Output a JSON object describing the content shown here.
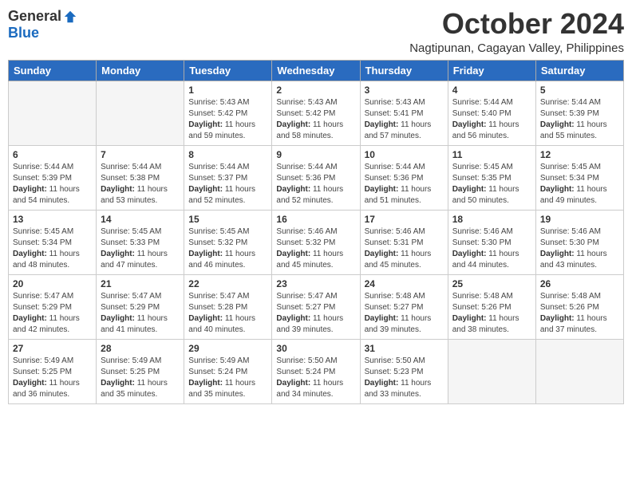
{
  "logo": {
    "general": "General",
    "blue": "Blue"
  },
  "title": "October 2024",
  "location": "Nagtipunan, Cagayan Valley, Philippines",
  "days_of_week": [
    "Sunday",
    "Monday",
    "Tuesday",
    "Wednesday",
    "Thursday",
    "Friday",
    "Saturday"
  ],
  "weeks": [
    [
      {
        "day": "",
        "sunrise": "",
        "sunset": "",
        "daylight": ""
      },
      {
        "day": "",
        "sunrise": "",
        "sunset": "",
        "daylight": ""
      },
      {
        "day": "1",
        "sunrise": "Sunrise: 5:43 AM",
        "sunset": "Sunset: 5:42 PM",
        "daylight": "Daylight: 11 hours and 59 minutes."
      },
      {
        "day": "2",
        "sunrise": "Sunrise: 5:43 AM",
        "sunset": "Sunset: 5:42 PM",
        "daylight": "Daylight: 11 hours and 58 minutes."
      },
      {
        "day": "3",
        "sunrise": "Sunrise: 5:43 AM",
        "sunset": "Sunset: 5:41 PM",
        "daylight": "Daylight: 11 hours and 57 minutes."
      },
      {
        "day": "4",
        "sunrise": "Sunrise: 5:44 AM",
        "sunset": "Sunset: 5:40 PM",
        "daylight": "Daylight: 11 hours and 56 minutes."
      },
      {
        "day": "5",
        "sunrise": "Sunrise: 5:44 AM",
        "sunset": "Sunset: 5:39 PM",
        "daylight": "Daylight: 11 hours and 55 minutes."
      }
    ],
    [
      {
        "day": "6",
        "sunrise": "Sunrise: 5:44 AM",
        "sunset": "Sunset: 5:39 PM",
        "daylight": "Daylight: 11 hours and 54 minutes."
      },
      {
        "day": "7",
        "sunrise": "Sunrise: 5:44 AM",
        "sunset": "Sunset: 5:38 PM",
        "daylight": "Daylight: 11 hours and 53 minutes."
      },
      {
        "day": "8",
        "sunrise": "Sunrise: 5:44 AM",
        "sunset": "Sunset: 5:37 PM",
        "daylight": "Daylight: 11 hours and 52 minutes."
      },
      {
        "day": "9",
        "sunrise": "Sunrise: 5:44 AM",
        "sunset": "Sunset: 5:36 PM",
        "daylight": "Daylight: 11 hours and 52 minutes."
      },
      {
        "day": "10",
        "sunrise": "Sunrise: 5:44 AM",
        "sunset": "Sunset: 5:36 PM",
        "daylight": "Daylight: 11 hours and 51 minutes."
      },
      {
        "day": "11",
        "sunrise": "Sunrise: 5:45 AM",
        "sunset": "Sunset: 5:35 PM",
        "daylight": "Daylight: 11 hours and 50 minutes."
      },
      {
        "day": "12",
        "sunrise": "Sunrise: 5:45 AM",
        "sunset": "Sunset: 5:34 PM",
        "daylight": "Daylight: 11 hours and 49 minutes."
      }
    ],
    [
      {
        "day": "13",
        "sunrise": "Sunrise: 5:45 AM",
        "sunset": "Sunset: 5:34 PM",
        "daylight": "Daylight: 11 hours and 48 minutes."
      },
      {
        "day": "14",
        "sunrise": "Sunrise: 5:45 AM",
        "sunset": "Sunset: 5:33 PM",
        "daylight": "Daylight: 11 hours and 47 minutes."
      },
      {
        "day": "15",
        "sunrise": "Sunrise: 5:45 AM",
        "sunset": "Sunset: 5:32 PM",
        "daylight": "Daylight: 11 hours and 46 minutes."
      },
      {
        "day": "16",
        "sunrise": "Sunrise: 5:46 AM",
        "sunset": "Sunset: 5:32 PM",
        "daylight": "Daylight: 11 hours and 45 minutes."
      },
      {
        "day": "17",
        "sunrise": "Sunrise: 5:46 AM",
        "sunset": "Sunset: 5:31 PM",
        "daylight": "Daylight: 11 hours and 45 minutes."
      },
      {
        "day": "18",
        "sunrise": "Sunrise: 5:46 AM",
        "sunset": "Sunset: 5:30 PM",
        "daylight": "Daylight: 11 hours and 44 minutes."
      },
      {
        "day": "19",
        "sunrise": "Sunrise: 5:46 AM",
        "sunset": "Sunset: 5:30 PM",
        "daylight": "Daylight: 11 hours and 43 minutes."
      }
    ],
    [
      {
        "day": "20",
        "sunrise": "Sunrise: 5:47 AM",
        "sunset": "Sunset: 5:29 PM",
        "daylight": "Daylight: 11 hours and 42 minutes."
      },
      {
        "day": "21",
        "sunrise": "Sunrise: 5:47 AM",
        "sunset": "Sunset: 5:29 PM",
        "daylight": "Daylight: 11 hours and 41 minutes."
      },
      {
        "day": "22",
        "sunrise": "Sunrise: 5:47 AM",
        "sunset": "Sunset: 5:28 PM",
        "daylight": "Daylight: 11 hours and 40 minutes."
      },
      {
        "day": "23",
        "sunrise": "Sunrise: 5:47 AM",
        "sunset": "Sunset: 5:27 PM",
        "daylight": "Daylight: 11 hours and 39 minutes."
      },
      {
        "day": "24",
        "sunrise": "Sunrise: 5:48 AM",
        "sunset": "Sunset: 5:27 PM",
        "daylight": "Daylight: 11 hours and 39 minutes."
      },
      {
        "day": "25",
        "sunrise": "Sunrise: 5:48 AM",
        "sunset": "Sunset: 5:26 PM",
        "daylight": "Daylight: 11 hours and 38 minutes."
      },
      {
        "day": "26",
        "sunrise": "Sunrise: 5:48 AM",
        "sunset": "Sunset: 5:26 PM",
        "daylight": "Daylight: 11 hours and 37 minutes."
      }
    ],
    [
      {
        "day": "27",
        "sunrise": "Sunrise: 5:49 AM",
        "sunset": "Sunset: 5:25 PM",
        "daylight": "Daylight: 11 hours and 36 minutes."
      },
      {
        "day": "28",
        "sunrise": "Sunrise: 5:49 AM",
        "sunset": "Sunset: 5:25 PM",
        "daylight": "Daylight: 11 hours and 35 minutes."
      },
      {
        "day": "29",
        "sunrise": "Sunrise: 5:49 AM",
        "sunset": "Sunset: 5:24 PM",
        "daylight": "Daylight: 11 hours and 35 minutes."
      },
      {
        "day": "30",
        "sunrise": "Sunrise: 5:50 AM",
        "sunset": "Sunset: 5:24 PM",
        "daylight": "Daylight: 11 hours and 34 minutes."
      },
      {
        "day": "31",
        "sunrise": "Sunrise: 5:50 AM",
        "sunset": "Sunset: 5:23 PM",
        "daylight": "Daylight: 11 hours and 33 minutes."
      },
      {
        "day": "",
        "sunrise": "",
        "sunset": "",
        "daylight": ""
      },
      {
        "day": "",
        "sunrise": "",
        "sunset": "",
        "daylight": ""
      }
    ]
  ]
}
